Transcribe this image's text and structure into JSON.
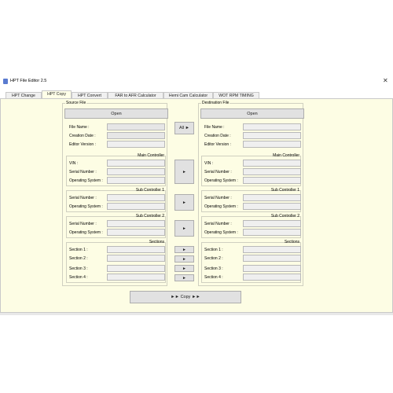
{
  "window": {
    "title": "HPT File Editor 2.5",
    "close": "✕"
  },
  "tabs": [
    {
      "label": "HPT Change"
    },
    {
      "label": "HPT Copy"
    },
    {
      "label": "HPT Convert"
    },
    {
      "label": "FAR to AFR Calculator"
    },
    {
      "label": "Hemi Cam Calculator"
    },
    {
      "label": "WOT RPM TIMING"
    }
  ],
  "source": {
    "title": "Source File",
    "open_label": "Open",
    "fields": [
      "File Name :",
      "Creation Date :",
      "Editor Version :"
    ],
    "main_controller": {
      "title": "Main Controller",
      "fields": [
        "VIN :",
        "Serial Number :",
        "Operating System :"
      ]
    },
    "sub_controller_1": {
      "title": "Sub Controller 1",
      "fields": [
        "Serial Number :",
        "Operating System :"
      ]
    },
    "sub_controller_2": {
      "title": "Sub Controller 2",
      "fields": [
        "Serial Number :",
        "Operating System :"
      ]
    },
    "sections": {
      "title": "Sections",
      "fields": [
        "Section 1 :",
        "Section 2 :",
        "Section 3 :",
        "Section 4 :"
      ]
    }
  },
  "destination": {
    "title": "Destination File",
    "open_label": "Open",
    "fields": [
      "File Name :",
      "Creation Date :",
      "Editor Version :"
    ],
    "main_controller": {
      "title": "Main Controller",
      "fields": [
        "VIN :",
        "Serial Number :",
        "Operating System :"
      ]
    },
    "sub_controller_1": {
      "title": "Sub Controller 1",
      "fields": [
        "Serial Number :",
        "Operating System :"
      ]
    },
    "sub_controller_2": {
      "title": "Sub Controller 2",
      "fields": [
        "Serial Number :",
        "Operating System :"
      ]
    },
    "sections": {
      "title": "Sections",
      "fields": [
        "Section 1 :",
        "Section 2 :",
        "Section 3 :",
        "Section 4 :"
      ]
    }
  },
  "middle": {
    "all_label": "All ►",
    "arrow": "►"
  },
  "copy_label": "►► Copy ►►",
  "colors": {
    "panel_bg": "#fdfde4",
    "field_bg": "#e6e6e6",
    "button_bg": "#e1e1e1"
  }
}
